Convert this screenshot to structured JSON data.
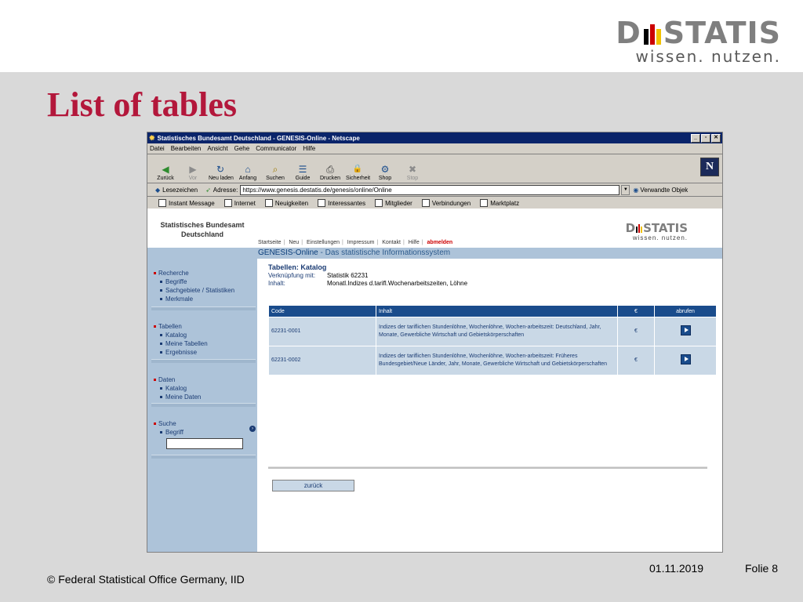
{
  "slide": {
    "title": "List of tables",
    "logo_word_left": "D",
    "logo_word_right": "STATIS",
    "logo_tagline": "wissen. nutzen.",
    "footer_copyright": "© Federal Statistical Office Germany, IID",
    "footer_date": "01.11.2019",
    "footer_page": "Folie 8"
  },
  "colors": {
    "title_red": "#b3173b",
    "bar_black": "#000000",
    "bar_red": "#cc0000",
    "bar_gold": "#f2c200",
    "nav_blue": "#1a4c8c",
    "side_blue": "#adc3d9"
  },
  "browser": {
    "window_title": "Statistisches Bundesamt Deutschland - GENESIS-Online - Netscape",
    "menu": [
      "Datei",
      "Bearbeiten",
      "Ansicht",
      "Gehe",
      "Communicator",
      "Hilfe"
    ],
    "toolbar": [
      {
        "label": "Zurück",
        "icon": "back-arrow-icon",
        "glyph": "◀"
      },
      {
        "label": "Vor",
        "icon": "forward-arrow-icon",
        "glyph": "▶"
      },
      {
        "label": "Neu laden",
        "icon": "reload-icon",
        "glyph": "↻"
      },
      {
        "label": "Anfang",
        "icon": "home-icon",
        "glyph": "⌂"
      },
      {
        "label": "Suchen",
        "icon": "search-icon",
        "glyph": "⌕"
      },
      {
        "label": "Guide",
        "icon": "guide-icon",
        "glyph": "☰"
      },
      {
        "label": "Drucken",
        "icon": "print-icon",
        "glyph": "⎙"
      },
      {
        "label": "Sicherheit",
        "icon": "lock-icon",
        "glyph": "🔒"
      },
      {
        "label": "Shop",
        "icon": "shop-icon",
        "glyph": "⚙"
      },
      {
        "label": "Stop",
        "icon": "stop-icon",
        "glyph": "✖"
      }
    ],
    "bookmarks_label": "Lesezeichen",
    "address_label": "Adresse:",
    "address_value": "https://www.genesis.destatis.de/genesis/online/Online",
    "related_label": "Verwandte Objek",
    "personal_bar": [
      "Instant Message",
      "Internet",
      "Neuigkeiten",
      "Interessantes",
      "Mitglieder",
      "Verbindungen",
      "Marktplatz"
    ]
  },
  "site": {
    "org_name_line1": "Statistisches Bundesamt",
    "org_name_line2": "Deutschland",
    "nav": [
      "Startseite",
      "Neu",
      "Einstellungen",
      "Impressum",
      "Kontakt",
      "Hilfe"
    ],
    "logout_label": "abmelden",
    "mini_logo_left": "D",
    "mini_logo_right": "STATIS",
    "mini_logo_tagline": "wissen. nutzen.",
    "genesis_title": "GENESIS-Online",
    "genesis_subtitle": "- Das statistische Informationssystem"
  },
  "sidebar": {
    "sections": [
      {
        "heading": "Recherche",
        "items": [
          "Begriffe",
          "Sachgebiete / Statistiken",
          "Merkmale"
        ]
      },
      {
        "heading": "Tabellen",
        "items": [
          "Katalog",
          "Meine Tabellen",
          "Ergebnisse"
        ]
      },
      {
        "heading": "Daten",
        "items": [
          "Katalog",
          "Meine Daten"
        ]
      },
      {
        "heading": "Suche",
        "items": [
          "Begriff"
        ]
      }
    ]
  },
  "main": {
    "heading": "Tabellen: Katalog",
    "link_label": "Verknüpfung mit:",
    "link_value": "Statistik 62231",
    "content_label": "Inhalt:",
    "content_value": "Monatl.Indizes d.tarifl.Wochenarbeitszeiten, Löhne",
    "table": {
      "headers": {
        "code": "Code",
        "inhalt": "Inhalt",
        "euro": "€",
        "abrufen": "abrufen"
      },
      "rows": [
        {
          "code": "62231-0001",
          "inhalt": "Indizes der tariflichen Stundenlöhne, Wochenlöhne, Wochen-arbeitszeit: Deutschland, Jahr, Monate, Gewerbliche Wirtschaft und Gebietskörperschaften",
          "euro": "€"
        },
        {
          "code": "62231-0002",
          "inhalt": "Indizes der tariflichen Stundenlöhne, Wochenlöhne, Wochen-arbeitszeit: Früheres Bundesgebiet/Neue Länder, Jahr, Monate, Gewerbliche Wirtschaft und Gebietskörperschaften",
          "euro": "€"
        }
      ]
    },
    "back_label": "zurück"
  }
}
